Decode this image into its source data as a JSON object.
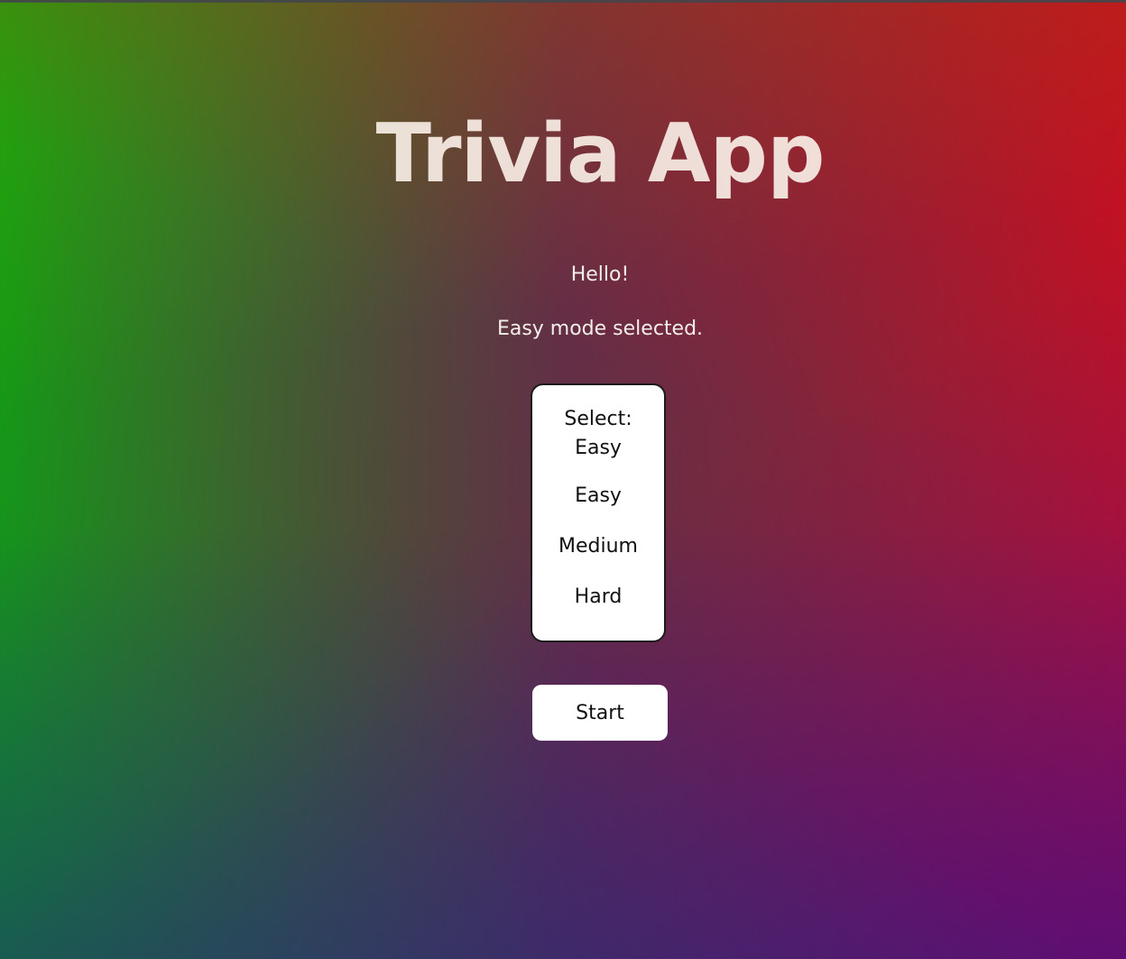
{
  "app": {
    "title": "Trivia App",
    "greeting": "Hello!",
    "mode_message": "Easy mode selected."
  },
  "difficulty_select": {
    "header_label": "Select:",
    "selected_value": "Easy",
    "options": [
      {
        "label": "Easy"
      },
      {
        "label": "Medium"
      },
      {
        "label": "Hard"
      }
    ]
  },
  "actions": {
    "start_label": "Start"
  },
  "colors": {
    "left_gradient": "#12a012",
    "right_gradient": "#c0102a",
    "bottom_gradient": "#2a1090",
    "panel_background": "#ffffff",
    "title_text": "#f8eee6"
  }
}
